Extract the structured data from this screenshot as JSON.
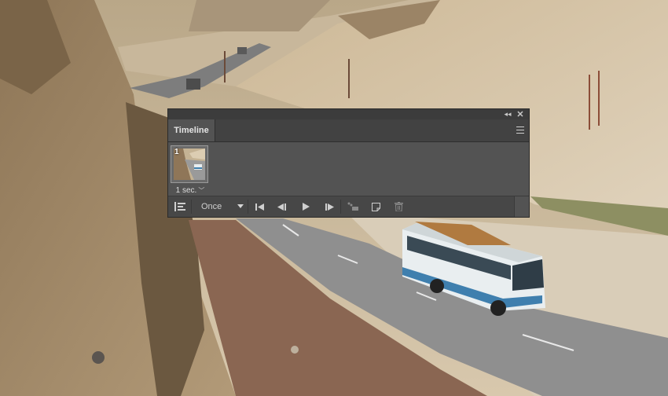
{
  "panel": {
    "tab_label": "Timeline",
    "icons": {
      "collapse": "double-chevron-left-icon",
      "close": "close-icon",
      "menu": "hamburger-menu-icon"
    }
  },
  "frames": [
    {
      "number": "1",
      "delay": "1 sec."
    }
  ],
  "controls": {
    "loop_value": "Once",
    "buttons": [
      "first-frame-icon",
      "previous-frame-icon",
      "play-icon",
      "next-frame-icon",
      "tween-icon",
      "duplicate-frame-icon",
      "delete-frame-icon"
    ]
  },
  "colors": {
    "panel_bg": "#535353",
    "tab_bar_bg": "#424242",
    "controls_bg": "#474747"
  }
}
